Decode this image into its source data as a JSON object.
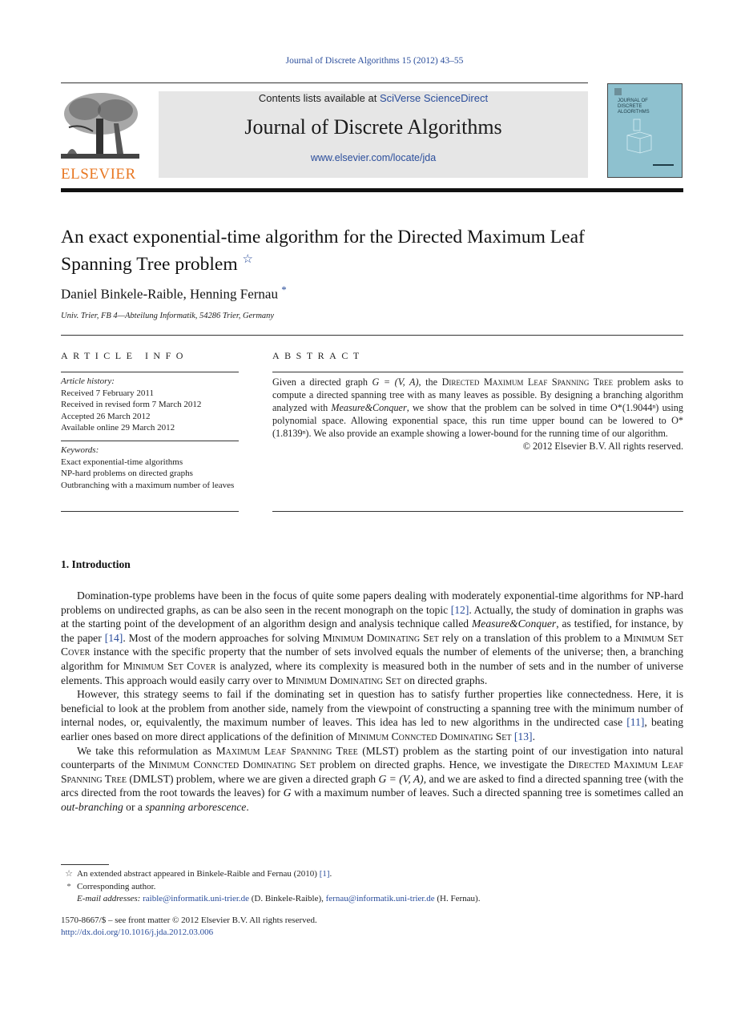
{
  "header": {
    "citation": "Journal of Discrete Algorithms 15 (2012) 43–55",
    "publisher_logo_text": "ELSEVIER",
    "contents_prefix": "Contents lists available at ",
    "contents_link": "SciVerse ScienceDirect",
    "journal_name": "Journal of Discrete Algorithms",
    "journal_url": "www.elsevier.com/locate/jda",
    "cover_title": [
      "JOURNAL OF",
      "DISCRETE",
      "ALGORITHMS"
    ]
  },
  "article": {
    "title_line1": "An exact exponential-time algorithm for the Directed Maximum Leaf",
    "title_line2": "Spanning Tree problem",
    "title_note_mark": "☆",
    "authors": "Daniel Binkele-Raible, Henning Fernau",
    "corresponding_mark": "*",
    "affiliation": "Univ. Trier, FB 4—Abteilung Informatik, 54286 Trier, Germany"
  },
  "article_info": {
    "label": "ARTICLE INFO",
    "history_heading": "Article history:",
    "history": [
      "Received 7 February 2011",
      "Received in revised form 7 March 2012",
      "Accepted 26 March 2012",
      "Available online 29 March 2012"
    ],
    "keywords_heading": "Keywords:",
    "keywords": [
      "Exact exponential-time algorithms",
      "NP-hard problems on directed graphs",
      "Outbranching with a maximum number of leaves"
    ]
  },
  "abstract": {
    "label": "ABSTRACT",
    "s1": "Given a directed graph ",
    "graph": "G = (V, A)",
    "s2": ", the ",
    "problem": "Directed Maximum Leaf Spanning Tree",
    "s3": " problem asks to compute a directed spanning tree with as many leaves as possible. By designing a branching algorithm analyzed with ",
    "mc": "Measure&Conquer",
    "s4": ", we show that the problem can be solved in time ",
    "bound1": "O*(1.9044ⁿ)",
    "s5": " using polynomial space. Allowing exponential space, this run time upper bound can be lowered to ",
    "bound2": "O*(1.8139ⁿ)",
    "s6": ". We also provide an example showing a lower-bound for the running time of our algorithm.",
    "copyright": "© 2012 Elsevier B.V. All rights reserved."
  },
  "section1": {
    "heading": "1.  Introduction",
    "p1": {
      "a": "Domination-type problems have been in the focus of quite some papers dealing with moderately exponential-time algorithms for NP-hard problems on undirected graphs, as can be also seen in the recent monograph on the topic ",
      "ref1": "[12]",
      "b": ". Actually, the study of domination in graphs was at the starting point of the development of an algorithm design and analysis technique called ",
      "mc": "Measure&Conquer",
      "c": ", as testified, for instance, by the paper ",
      "ref2": "[14]",
      "d": ". Most of the modern approaches for solving ",
      "mds": "Minimum Dominating Set",
      "e": " rely on a translation of this problem to a ",
      "msc": "Minimum Set Cover",
      "f": " instance with the specific property that the number of sets involved equals the number of elements of the universe; then, a branching algorithm for ",
      "msc2": "Minimum Set Cover",
      "g": " is analyzed, where its complexity is measured both in the number of sets and in the number of universe elements. This approach would easily carry over to ",
      "mds2": "Minimum Dominating Set",
      "h": " on directed graphs."
    },
    "p2": {
      "a": "However, this strategy seems to fail if the dominating set in question has to satisfy further properties like connectedness. Here, it is beneficial to look at the problem from another side, namely from the viewpoint of constructing a spanning tree with the minimum number of internal nodes, or, equivalently, the maximum number of leaves. This idea has led to new algorithms in the undirected case ",
      "ref1": "[11]",
      "b": ", beating earlier ones based on more direct applications of the definition of ",
      "mcds": "Minimum Conncted Dominating Set",
      "c": " ",
      "ref2": "[13]",
      "d": "."
    },
    "p3": {
      "a": "We take this reformulation as ",
      "mlst": "Maximum Leaf Spanning Tree",
      "b": " (MLST) problem as the starting point of our investigation into natural counterparts of the ",
      "mcds": "Minimum Conncted Dominating Set",
      "c": " problem on directed graphs. Hence, we investigate the ",
      "dmlst": "Directed Maximum Leaf Spanning Tree",
      "d": " (DMLST) problem, where we are given a directed graph ",
      "graph": "G = (V, A)",
      "e": ", and we are asked to find a directed spanning tree (with the arcs directed from the root towards the leaves) for ",
      "g": "G",
      "f": " with a maximum number of leaves. Such a directed spanning tree is sometimes called an ",
      "ob": "out-branching",
      "h": " or a ",
      "sa": "spanning arborescence",
      "i": "."
    }
  },
  "footnotes": {
    "star_mark": "☆",
    "star_text_a": "An extended abstract appeared in Binkele-Raible and Fernau (2010) ",
    "star_ref": "[1]",
    "star_text_b": ".",
    "ast_mark": "*",
    "ast_text": "Corresponding author.",
    "email_label": "E-mail addresses: ",
    "email1": "raible@informatik.uni-trier.de",
    "email1_name": " (D. Binkele-Raible), ",
    "email2": "fernau@informatik.uni-trier.de",
    "email2_name": " (H. Fernau)."
  },
  "frontmatter": {
    "issn_line": "1570-8667/$ – see front matter  © 2012 Elsevier B.V. All rights reserved.",
    "doi": "http://dx.doi.org/10.1016/j.jda.2012.03.006"
  }
}
